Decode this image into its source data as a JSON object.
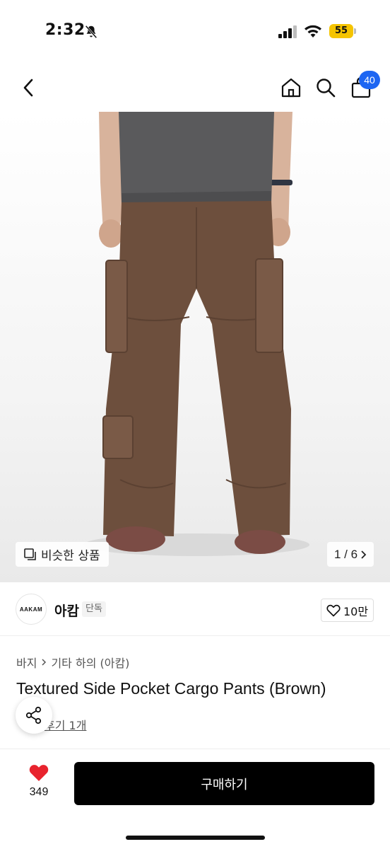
{
  "status_bar": {
    "time": "2:32",
    "battery": "55",
    "icons": [
      "bell-slash-icon",
      "signal-icon",
      "wifi-icon",
      "battery-icon"
    ]
  },
  "nav": {
    "icons": [
      "back-icon",
      "home-icon",
      "search-icon",
      "bag-icon"
    ],
    "cart_count": "40"
  },
  "gallery": {
    "similar_label": "비슷한 상품",
    "counter": "1 / 6",
    "colors": {
      "shirt": "#5a5a5c",
      "pants": "#6d4f3d",
      "shoes": "#7b4c45"
    }
  },
  "brand": {
    "logo_text": "AAKAM",
    "name": "아캄",
    "tag": "단독",
    "likes": "10만"
  },
  "product": {
    "category": [
      "바지",
      "기타 하의 (아캄)"
    ],
    "title": "Textured Side Pocket Cargo Pants (Brown)",
    "review_label": "후기 1개"
  },
  "bottom": {
    "wish_count": "349",
    "buy_label": "구매하기",
    "colors": {
      "accent": "#000000",
      "heart": "#e8232d",
      "badge": "#1d66f2",
      "battery": "#f5c400"
    }
  }
}
